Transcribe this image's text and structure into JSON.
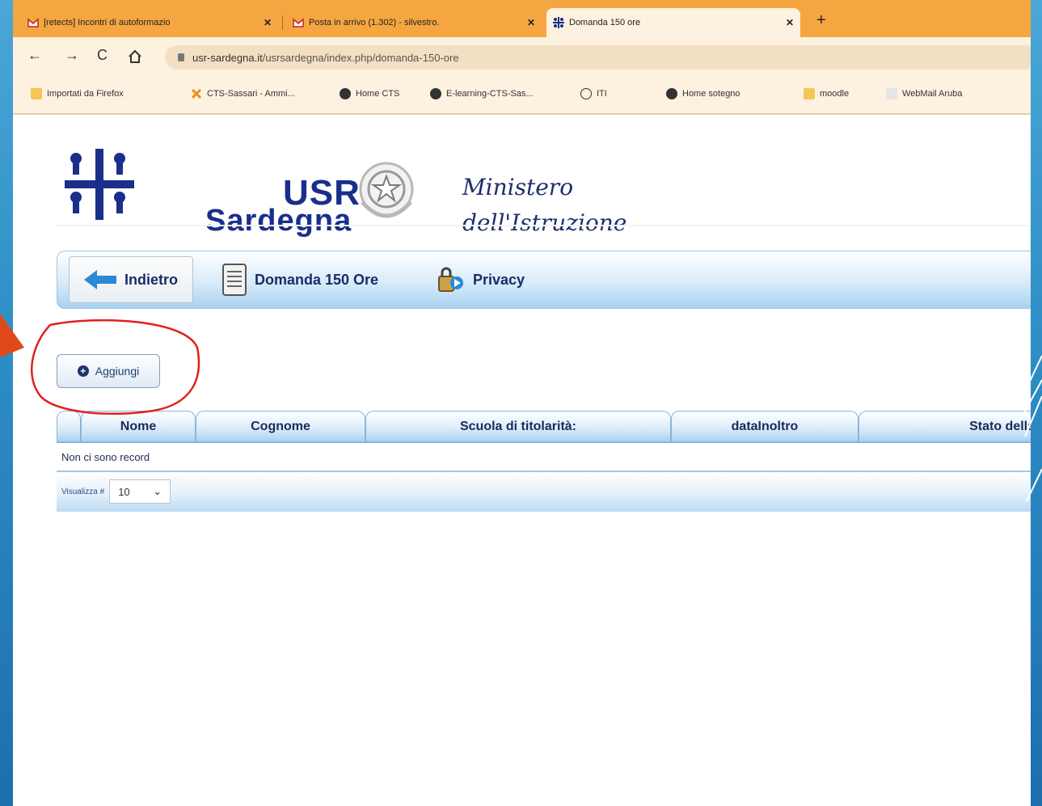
{
  "browser": {
    "tabs": [
      {
        "label": "[retects] Incontri di autoformazio",
        "icon": "gmail-icon",
        "active": false
      },
      {
        "label": "Posta in arrivo (1.302) - silvestro.",
        "icon": "gmail-icon",
        "active": false
      },
      {
        "label": "Domanda 150 ore",
        "icon": "usr-favicon-icon",
        "active": true
      }
    ],
    "new_tab": "+",
    "url_host": "usr-sardegna.it",
    "url_path": "/usrsardegna/index.php/domanda-150-ore",
    "bookmarks": [
      {
        "label": "Importati da Firefox",
        "icon": "folder-icon"
      },
      {
        "label": "CTS-Sassari - Ammi...",
        "icon": "joomla-icon"
      },
      {
        "label": "Home CTS",
        "icon": "globe-icon"
      },
      {
        "label": "E-learning-CTS-Sas...",
        "icon": "globe-icon"
      },
      {
        "label": "ITI",
        "icon": "iti-icon"
      },
      {
        "label": "Home sotegno",
        "icon": "globe-icon"
      },
      {
        "label": "moodle",
        "icon": "folder-icon"
      },
      {
        "label": "WebMail Aruba",
        "icon": "webmail-icon"
      }
    ]
  },
  "header": {
    "logo_usr": "USR",
    "logo_region": "Sardegna",
    "ministry_line1": "Ministero",
    "ministry_line2": "dell'Istruzione"
  },
  "toolbar": {
    "back_label": "Indietro",
    "domanda_label": "Domanda 150 Ore",
    "privacy_label": "Privacy"
  },
  "actions": {
    "add_label": "Aggiungi"
  },
  "grid": {
    "columns": [
      "Nome",
      "Cognome",
      "Scuola di titolarità:",
      "dataInoltro",
      "Stato della"
    ],
    "empty_message": "Non ci sono record",
    "page_size_label": "Visualizza #",
    "page_size_value": "10"
  },
  "colors": {
    "tabbar": "#f5a640",
    "toolbar_gradient_end": "#a9d2f1",
    "brand_dark": "#1a2f8a",
    "brand_light": "#2a7fd6",
    "annotation": "#e0211d"
  }
}
